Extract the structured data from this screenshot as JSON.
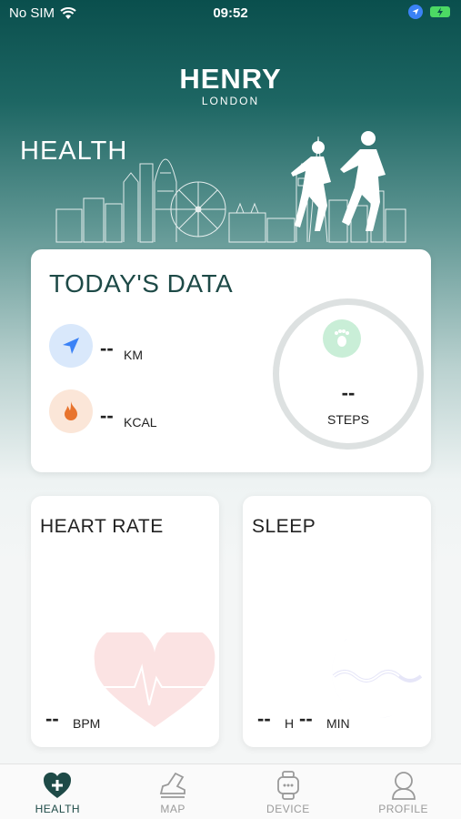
{
  "status_bar": {
    "carrier": "No SIM",
    "time": "09:52"
  },
  "brand": {
    "name": "HENRY",
    "subtitle": "LONDON"
  },
  "page_title": "HEALTH",
  "today": {
    "title": "TODAY'S DATA",
    "distance": {
      "value": "--",
      "unit": "KM",
      "icon": "location-arrow-icon"
    },
    "calories": {
      "value": "--",
      "unit": "KCAL",
      "icon": "flame-icon"
    },
    "steps": {
      "value": "--",
      "unit": "STEPS",
      "icon": "footprint-icon"
    }
  },
  "heart_rate": {
    "title": "HEART RATE",
    "value": "--",
    "unit": "BPM"
  },
  "sleep": {
    "title": "SLEEP",
    "hours_value": "--",
    "hours_unit": "H",
    "minutes_value": "--",
    "minutes_unit": "MIN"
  },
  "tabs": [
    {
      "label": "HEALTH",
      "icon": "heart-plus-icon",
      "active": true
    },
    {
      "label": "MAP",
      "icon": "shoe-icon",
      "active": false
    },
    {
      "label": "DEVICE",
      "icon": "watch-icon",
      "active": false
    },
    {
      "label": "PROFILE",
      "icon": "person-icon",
      "active": false
    }
  ],
  "colors": {
    "header_top": "#0a4f4d",
    "accent": "#1e4a47",
    "distance_icon": "#3b82f6",
    "calories_icon": "#e8742e",
    "steps_icon": "#5cc78a"
  }
}
